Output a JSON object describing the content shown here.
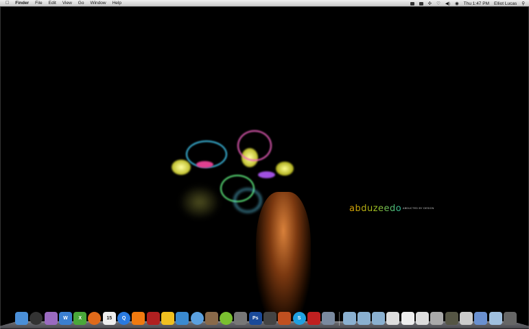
{
  "menubar": {
    "apple_icon": "apple-icon",
    "items": [
      "Finder",
      "File",
      "Edit",
      "View",
      "Go",
      "Window",
      "Help"
    ],
    "clock": "Thu 1:47 PM",
    "user": "Elliot Lucas",
    "status_icons": [
      "growl-icon",
      "display-icon",
      "bluetooth-icon",
      "wifi-icon",
      "volume-icon",
      "input-icon"
    ]
  },
  "wallpaper": {
    "logo": "abduzeedo",
    "tagline": "ABDUCTED BY DESIGN"
  },
  "dock": {
    "apps": [
      {
        "name": "finder",
        "color": "#4a8fd8",
        "glyph": ""
      },
      {
        "name": "dashboard",
        "color": "#333",
        "glyph": ""
      },
      {
        "name": "mail",
        "color": "#9a6ac0",
        "glyph": ""
      },
      {
        "name": "word",
        "color": "#3b7fd0",
        "glyph": "W"
      },
      {
        "name": "excel",
        "color": "#4aa83a",
        "glyph": "X"
      },
      {
        "name": "firefox",
        "color": "#e06a1a",
        "glyph": ""
      },
      {
        "name": "ical",
        "color": "#eee",
        "glyph": "15"
      },
      {
        "name": "quicktime",
        "color": "#2a7ae0",
        "glyph": "Q"
      },
      {
        "name": "vlc",
        "color": "#f07a10",
        "glyph": ""
      },
      {
        "name": "photo-booth",
        "color": "#b02020",
        "glyph": ""
      },
      {
        "name": "adium",
        "color": "#f0c020",
        "glyph": ""
      },
      {
        "name": "twitter",
        "color": "#3a8ad0",
        "glyph": ""
      },
      {
        "name": "itunes",
        "color": "#5aa0e0",
        "glyph": ""
      },
      {
        "name": "iphoto",
        "color": "#8a6a4a",
        "glyph": ""
      },
      {
        "name": "green-app",
        "color": "#7ac030",
        "glyph": ""
      },
      {
        "name": "system-preferences",
        "color": "#777",
        "glyph": ""
      },
      {
        "name": "photoshop",
        "color": "#1a4a9a",
        "glyph": "Ps"
      },
      {
        "name": "final-cut",
        "color": "#444",
        "glyph": ""
      },
      {
        "name": "keynote",
        "color": "#c05020",
        "glyph": ""
      },
      {
        "name": "skype",
        "color": "#20a0e0",
        "glyph": "S"
      },
      {
        "name": "parallels",
        "color": "#c02020",
        "glyph": ""
      },
      {
        "name": "preview",
        "color": "#7a8aa0",
        "glyph": ""
      }
    ],
    "stacks": [
      {
        "name": "folder",
        "color": "#8ab0d0"
      },
      {
        "name": "applications-folder",
        "color": "#8ab0d0"
      },
      {
        "name": "documents-folder",
        "color": "#8ab0d0"
      },
      {
        "name": "file-1",
        "color": "#ddd"
      },
      {
        "name": "file-2",
        "color": "#eee"
      },
      {
        "name": "file-3",
        "color": "#ddd"
      },
      {
        "name": "file-4",
        "color": "#aaa"
      },
      {
        "name": "file-5",
        "color": "#554"
      },
      {
        "name": "file-6",
        "color": "#ccc"
      },
      {
        "name": "file-7",
        "color": "#6a90d0"
      },
      {
        "name": "downloads-folder",
        "color": "#a0c0e0"
      },
      {
        "name": "trash",
        "color": "#666"
      }
    ]
  }
}
